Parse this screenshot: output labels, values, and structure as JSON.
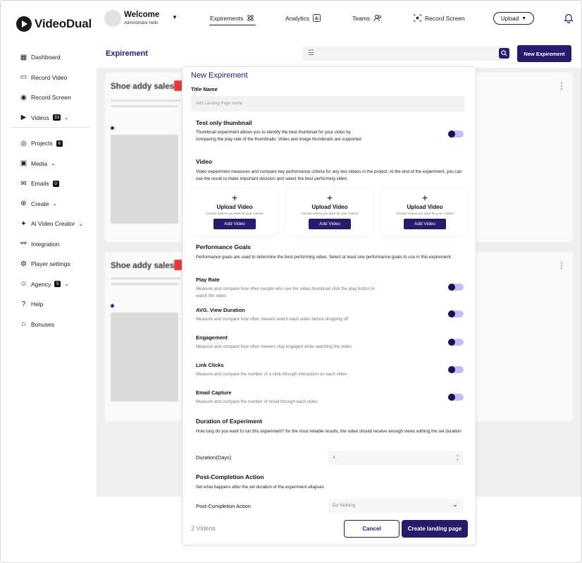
{
  "app": {
    "name": "VideoDual"
  },
  "header": {
    "welcome": "Welcome",
    "subtitle": "Adminstrator hello",
    "tabs": [
      {
        "label": "Expirements",
        "icon": "atom-icon"
      },
      {
        "label": "Analytics",
        "icon": "bar-chart-icon"
      },
      {
        "label": "Teams",
        "icon": "users-icon"
      },
      {
        "label": "Record Screen",
        "icon": "record-screen-icon"
      }
    ],
    "upload_label": "Upload"
  },
  "sidebar": {
    "items": [
      {
        "label": "Dashboard",
        "icon": "grid-icon"
      },
      {
        "label": "Record Video",
        "icon": "video-icon"
      },
      {
        "label": "Record Screen",
        "icon": "record-screen-icon"
      },
      {
        "label": "Videos",
        "icon": "videos-icon",
        "badge": "33"
      },
      {
        "label": "Projects",
        "icon": "target-icon",
        "badge": "6"
      },
      {
        "label": "Media",
        "icon": "media-icon"
      },
      {
        "label": "Emails",
        "icon": "mail-icon",
        "badge": "0"
      },
      {
        "label": "Create",
        "icon": "plus-circle-icon"
      },
      {
        "label": "Ai Video Creator",
        "icon": "sparkle-icon"
      },
      {
        "label": "Integration",
        "icon": "link-icon"
      },
      {
        "label": "Player settings",
        "icon": "settings-icon"
      },
      {
        "label": "Agency",
        "icon": "agency-icon",
        "badge": "5"
      },
      {
        "label": "Help",
        "icon": "help-icon"
      },
      {
        "label": "Bonuses",
        "icon": "gift-icon"
      }
    ]
  },
  "page": {
    "title": "Expirement",
    "new_button": "New Expirement"
  },
  "cards": [
    {
      "title": "Shoe addy sales"
    },
    {
      "title": "Shoe addy sales"
    }
  ],
  "modal": {
    "title": "New Expirement",
    "title_name_label": "Title Name",
    "title_name_placeholder": "Add Landing Page name",
    "thumbnail": {
      "heading": "Test only thumbnail",
      "description": "Thumbnail experiment allows you to identify the best thumbnail for your video by comparing the play rate of the thumbnails. Video and image thumbnails are supported",
      "enabled": true
    },
    "video": {
      "heading": "Video",
      "description": "Video experiment measures and compare key performance criteria for any two videos in the project. At the end of the experiment, you can use the result to make important decision and select the best performing video",
      "upload_cards": [
        {
          "title": "Upload Video",
          "subtitle": "Choose videos you want for your content",
          "button": "Add Video"
        },
        {
          "title": "Upload Video",
          "subtitle": "Choose videos you want for your content",
          "button": "Add Video"
        },
        {
          "title": "Upload Video",
          "subtitle": "Choose videos you want for your content",
          "button": "Add Video"
        }
      ]
    },
    "goals": {
      "heading": "Performance Goals",
      "description": "Performance goals are used to determine the best performing video. Select at least one performance goals to use in this expirement.",
      "items": [
        {
          "label": "Play Rate",
          "description": "Measure and compare how often people who see the video thumbnail click the play button to watch the video",
          "enabled": true
        },
        {
          "label": "AVG. View Duration",
          "description": "Measure and compare how often viewers watch each video before dropping off",
          "enabled": true
        },
        {
          "label": "Engagement",
          "description": "Measure and compare how often viewers stay engaged while watching the video",
          "enabled": true
        },
        {
          "label": "Link Clicks",
          "description": "Measure and compare the number of a click-through interaction on each video",
          "enabled": true
        },
        {
          "label": "Email Capture",
          "description": "Measure and compare the number of email through each video",
          "enabled": true
        }
      ]
    },
    "duration": {
      "heading": "Duration of Experiment",
      "description": "How long do you want to run this experiment? for the most reliable results, the video should receive enough views withing the set duration",
      "field_label": "Duration(Days)",
      "value": "4"
    },
    "post_completion": {
      "heading": "Post-Completion Action",
      "description": "Set what happens after the set duration of the experiment ellapses",
      "field_label": "Post-Completion Action",
      "value": "Do Nothing"
    },
    "footer": {
      "count": "2 Videos",
      "cancel": "Cancel",
      "create": "Create landing page"
    }
  },
  "colors": {
    "accent": "#2a1a6e",
    "toggle_track": "#c8bdf2",
    "tag_red": "#e23c3c"
  }
}
